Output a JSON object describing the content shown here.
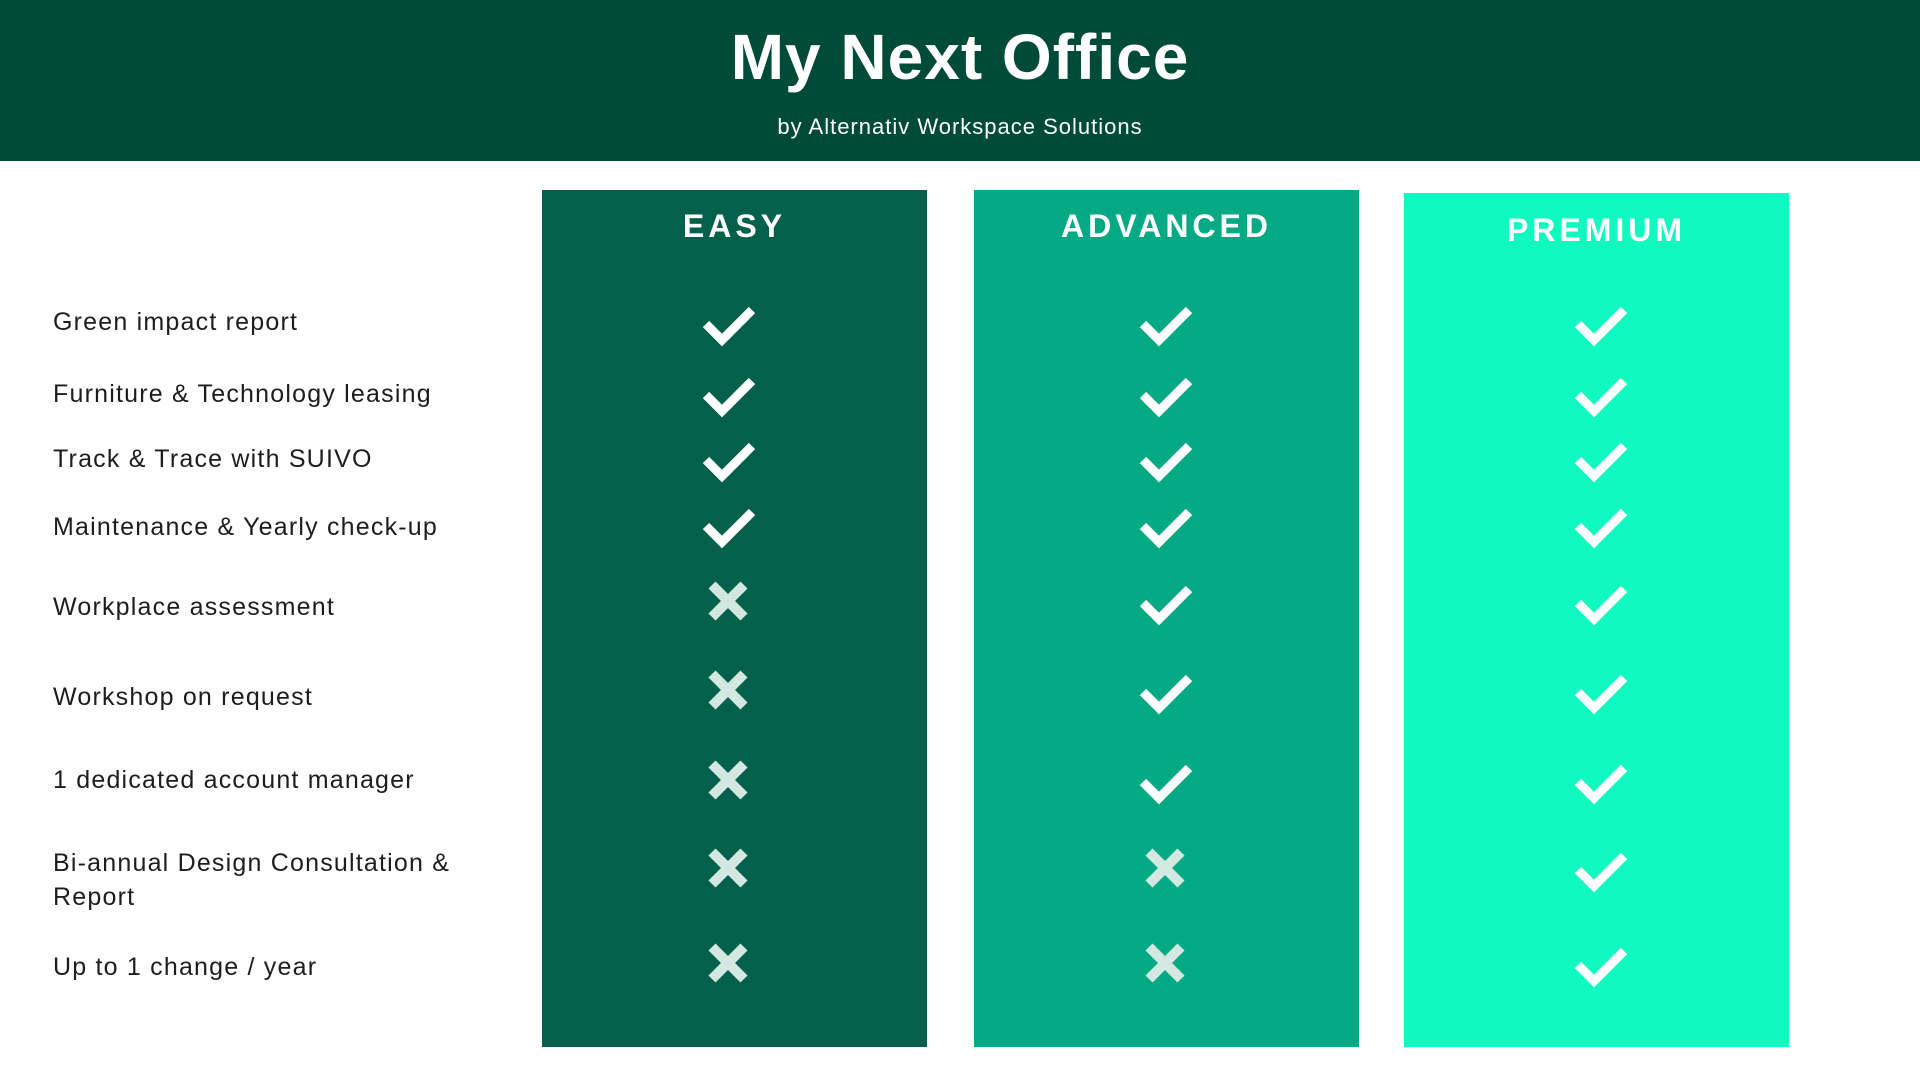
{
  "header": {
    "title": "My Next Office",
    "subtitle": "by Alternativ Workspace Solutions"
  },
  "colors": {
    "header_bg": "#004b37",
    "easy": "#03614b",
    "advanced": "#05aa84",
    "premium": "#10f9c1",
    "check": "#ffffff",
    "cross": "#d3e8e1"
  },
  "plans": [
    {
      "name": "EASY"
    },
    {
      "name": "ADVANCED"
    },
    {
      "name": "PREMIUM"
    }
  ],
  "features": [
    {
      "label": "Green impact report",
      "included": [
        true,
        true,
        true
      ]
    },
    {
      "label": "Furniture & Technology  leasing",
      "included": [
        true,
        true,
        true
      ]
    },
    {
      "label": "Track & Trace with SUIVO",
      "included": [
        true,
        true,
        true
      ]
    },
    {
      "label": "Maintenance & Yearly check-up",
      "included": [
        true,
        true,
        true
      ]
    },
    {
      "label": "Workplace assessment",
      "included": [
        false,
        true,
        true
      ]
    },
    {
      "label": "Workshop on request",
      "included": [
        false,
        true,
        true
      ]
    },
    {
      "label": "1 dedicated account manager",
      "included": [
        false,
        true,
        true
      ]
    },
    {
      "label": "Bi-annual Design Consultation & Report",
      "included": [
        false,
        false,
        true
      ]
    },
    {
      "label": "Up to 1 change / year",
      "included": [
        false,
        false,
        true
      ]
    }
  ]
}
